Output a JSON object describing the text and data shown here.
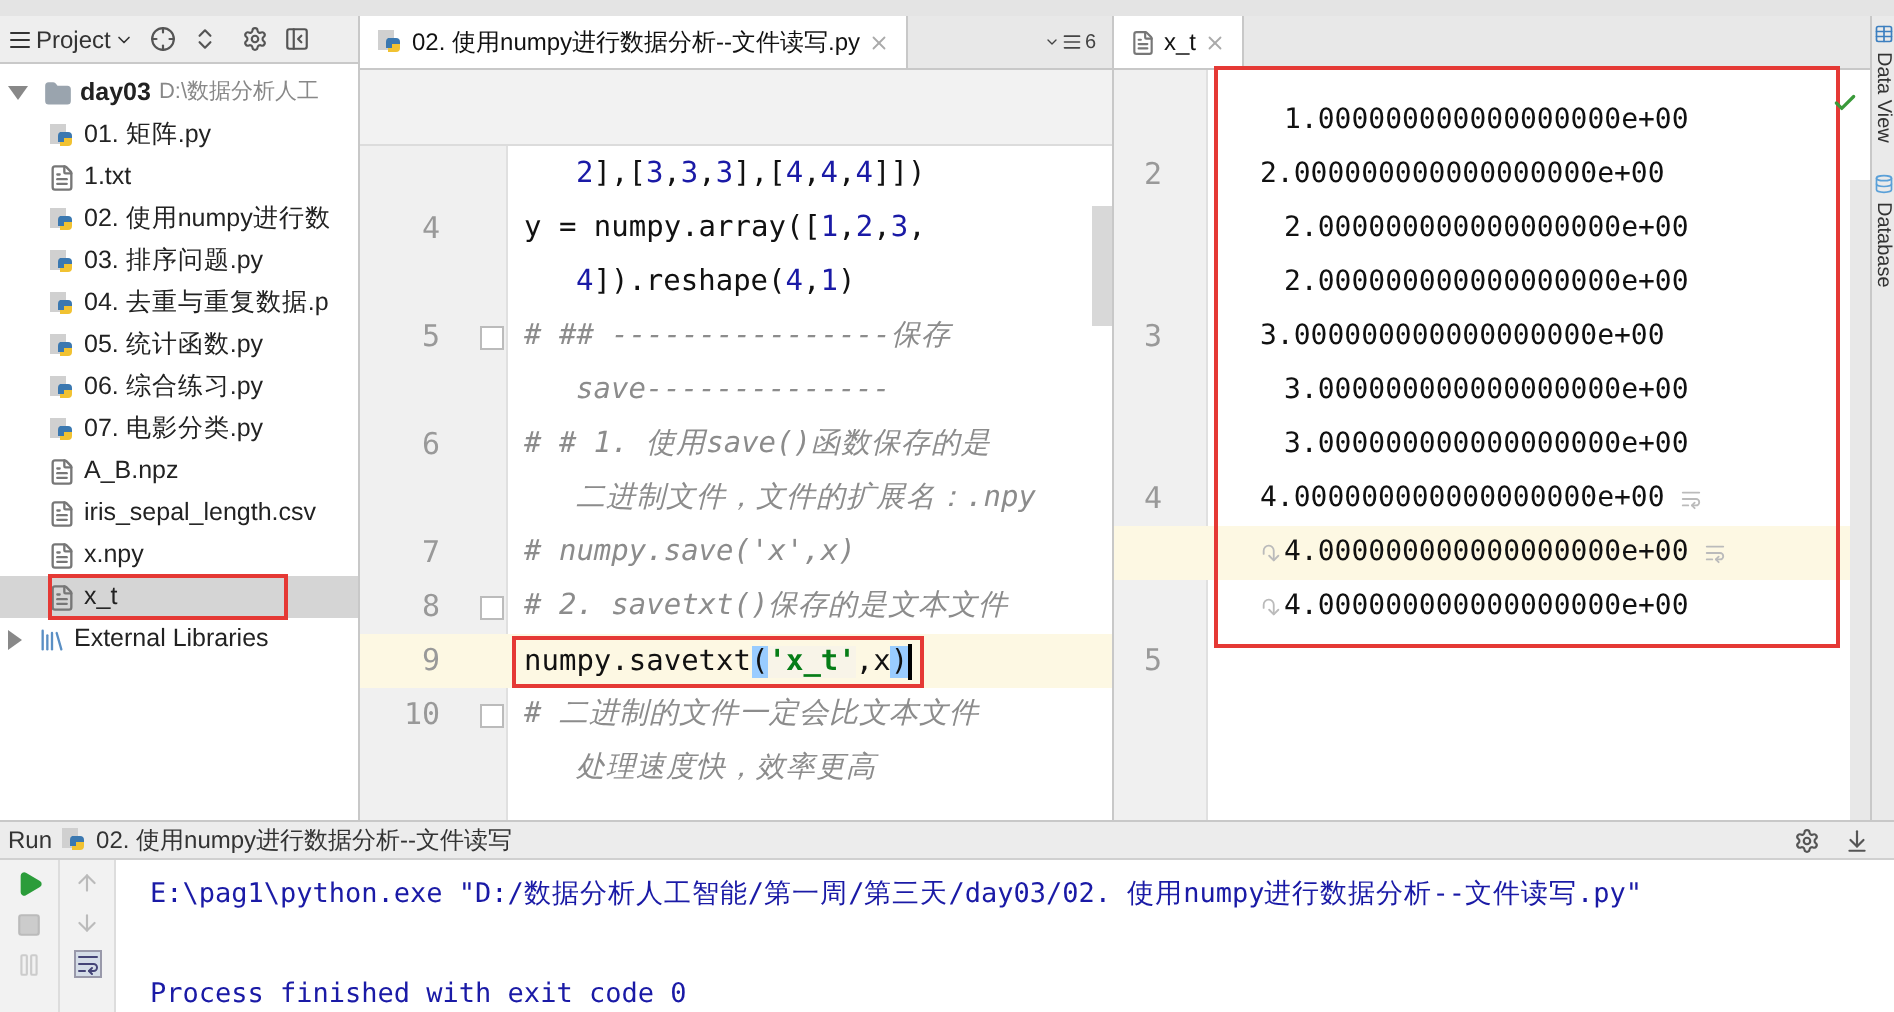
{
  "project_panel": {
    "title": "Project",
    "tree": [
      {
        "label": "day03",
        "path": "D:\\数据分析人工",
        "kind": "folder",
        "expanded": true,
        "selected": false,
        "children": [
          {
            "label": "01. 矩阵.py",
            "kind": "python",
            "selected": false
          },
          {
            "label": "1.txt",
            "kind": "text",
            "selected": false
          },
          {
            "label": "02. 使用numpy进行数",
            "kind": "python",
            "selected": false
          },
          {
            "label": "03. 排序问题.py",
            "kind": "python",
            "selected": false
          },
          {
            "label": "04. 去重与重复数据.p",
            "kind": "python",
            "selected": false
          },
          {
            "label": "05. 统计函数.py",
            "kind": "python",
            "selected": false
          },
          {
            "label": "06. 综合练习.py",
            "kind": "python",
            "selected": false
          },
          {
            "label": "07. 电影分类.py",
            "kind": "python",
            "selected": false
          },
          {
            "label": "A_B.npz",
            "kind": "text",
            "selected": false
          },
          {
            "label": "iris_sepal_length.csv",
            "kind": "text",
            "selected": false
          },
          {
            "label": "x.npy",
            "kind": "text",
            "selected": false
          },
          {
            "label": "x_t",
            "kind": "text",
            "selected": true
          }
        ]
      },
      {
        "label": "External Libraries",
        "kind": "library",
        "expanded": false,
        "selected": false
      }
    ]
  },
  "left_editor": {
    "tab": "02. 使用numpy进行数据分析--文件读写.py",
    "tab_count": "6",
    "lines": [
      {
        "segments": [
          {
            "kind": "number",
            "text": "2"
          },
          {
            "kind": "plain",
            "text": "],["
          },
          {
            "kind": "number",
            "text": "3"
          },
          {
            "kind": "plain",
            "text": ","
          },
          {
            "kind": "number",
            "text": "3"
          },
          {
            "kind": "plain",
            "text": ","
          },
          {
            "kind": "number",
            "text": "3"
          },
          {
            "kind": "plain",
            "text": "],["
          },
          {
            "kind": "number",
            "text": "4"
          },
          {
            "kind": "plain",
            "text": ","
          },
          {
            "kind": "number",
            "text": "4"
          },
          {
            "kind": "plain",
            "text": ","
          },
          {
            "kind": "number",
            "text": "4"
          },
          {
            "kind": "plain",
            "text": "]])"
          }
        ],
        "current": false
      },
      {
        "number": "4",
        "segments": [
          {
            "kind": "plain",
            "text": "y = numpy.array(["
          },
          {
            "kind": "number",
            "text": "1"
          },
          {
            "kind": "plain",
            "text": ","
          },
          {
            "kind": "number",
            "text": "2"
          },
          {
            "kind": "plain",
            "text": ","
          },
          {
            "kind": "number",
            "text": "3"
          },
          {
            "kind": "plain",
            "text": ","
          }
        ],
        "current": false
      },
      {
        "segments": [
          {
            "kind": "number",
            "text": "4"
          },
          {
            "kind": "plain",
            "text": "]).reshape("
          },
          {
            "kind": "number",
            "text": "4"
          },
          {
            "kind": "plain",
            "text": ","
          },
          {
            "kind": "number",
            "text": "1"
          },
          {
            "kind": "plain",
            "text": ")"
          }
        ],
        "current": false
      },
      {
        "number": "5",
        "segments": [
          {
            "kind": "comment",
            "text": "# ## ----------------保存"
          }
        ],
        "current": false,
        "fold": true
      },
      {
        "segments": [
          {
            "kind": "comment",
            "text": "save--------------"
          }
        ],
        "current": false
      },
      {
        "number": "6",
        "segments": [
          {
            "kind": "comment",
            "text": "# # 1. 使用save()函数保存的是"
          }
        ],
        "current": false
      },
      {
        "segments": [
          {
            "kind": "comment",
            "text": "二进制文件，文件的扩展名：.npy"
          }
        ],
        "current": false
      },
      {
        "number": "7",
        "segments": [
          {
            "kind": "comment",
            "text": "# numpy.save('x',x)"
          }
        ],
        "current": false
      },
      {
        "number": "8",
        "segments": [
          {
            "kind": "comment",
            "text": "# 2. savetxt()保存的是文本文件"
          }
        ],
        "current": false,
        "fold": true
      },
      {
        "number": "9",
        "segments": [
          {
            "kind": "plain",
            "text": "numpy.savetxt"
          },
          {
            "kind": "brace",
            "text": "("
          },
          {
            "kind": "string",
            "text": "'x_t'"
          },
          {
            "kind": "plain",
            "text": ",x"
          },
          {
            "kind": "brace",
            "text": ")"
          }
        ],
        "current": true
      },
      {
        "number": "10",
        "segments": [
          {
            "kind": "comment",
            "text": "# 二进制的文件一定会比文本文件"
          }
        ],
        "current": false,
        "fold": true
      },
      {
        "segments": [
          {
            "kind": "comment",
            "text": "处理速度快，效率更高"
          }
        ],
        "current": false
      }
    ]
  },
  "right_editor": {
    "tab": "x_t",
    "rows": [
      {
        "text": "1.000000000000000000e+00",
        "current": false
      },
      {
        "number": "2",
        "text": "2.000000000000000000e+00",
        "current": false
      },
      {
        "text": "2.000000000000000000e+00",
        "current": false
      },
      {
        "text": "2.000000000000000000e+00",
        "current": false
      },
      {
        "number": "3",
        "text": "3.000000000000000000e+00",
        "current": false
      },
      {
        "text": "3.000000000000000000e+00",
        "current": false
      },
      {
        "text": "3.000000000000000000e+00",
        "current": false
      },
      {
        "number": "4",
        "text": "4.000000000000000000e+00",
        "current": false,
        "wrap_end": true
      },
      {
        "text": "4.000000000000000000e+00",
        "current": true,
        "wrap_start": true,
        "wrap_end": true
      },
      {
        "text": "4.000000000000000000e+00",
        "current": false,
        "wrap_start": true
      },
      {
        "number": "5",
        "current": false
      }
    ]
  },
  "side_tools": [
    {
      "label": "Data View",
      "kind": "table"
    },
    {
      "label": "Database",
      "kind": "database"
    }
  ],
  "run_panel": {
    "label": "Run",
    "config": "02. 使用numpy进行数据分析--文件读写",
    "output": [
      {
        "text": "E:\\pag1\\python.exe \"D:/数据分析人工智能/第一周/第三天/day03/02. 使用numpy进行数据分析--文件读写.py\""
      },
      {
        "text": "Process finished with exit code 0"
      }
    ]
  }
}
